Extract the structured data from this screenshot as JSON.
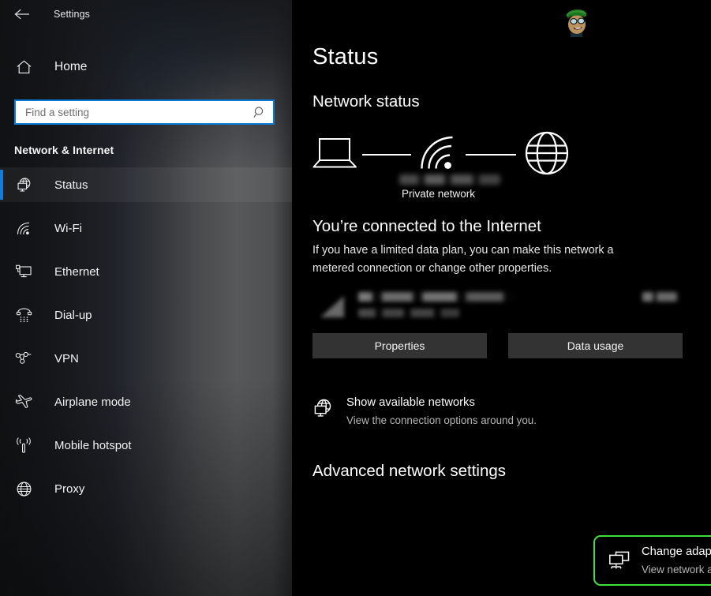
{
  "window": {
    "app_title": "Settings",
    "back_icon": "back-arrow-icon"
  },
  "sidebar": {
    "home": {
      "label": "Home",
      "icon": "home-icon"
    },
    "search": {
      "placeholder": "Find a setting",
      "value": "",
      "icon": "search-icon"
    },
    "category": "Network & Internet",
    "items": [
      {
        "label": "Status",
        "icon": "network-status-icon",
        "selected": true
      },
      {
        "label": "Wi-Fi",
        "icon": "wifi-icon",
        "selected": false
      },
      {
        "label": "Ethernet",
        "icon": "ethernet-icon",
        "selected": false
      },
      {
        "label": "Dial-up",
        "icon": "dialup-phone-icon",
        "selected": false
      },
      {
        "label": "VPN",
        "icon": "vpn-icon",
        "selected": false
      },
      {
        "label": "Airplane mode",
        "icon": "airplane-icon",
        "selected": false
      },
      {
        "label": "Mobile hotspot",
        "icon": "hotspot-icon",
        "selected": false
      },
      {
        "label": "Proxy",
        "icon": "globe-icon",
        "selected": false
      }
    ],
    "accent_color": "#0f7ce0"
  },
  "main": {
    "page_title": "Status",
    "section_network_status": "Network status",
    "diagram": {
      "device_icon": "laptop-icon",
      "signal_icon": "wifi-signal-icon",
      "internet_icon": "globe-icon",
      "ssid_label": "",
      "network_type": "Private network"
    },
    "connected_heading": "You’re connected to the Internet",
    "connected_description": "If you have a limited data plan, you can make this network a metered connection or change other properties.",
    "usage_row": {
      "name": "",
      "subtitle": "",
      "size": "",
      "icon": "wifi-usage-icon"
    },
    "buttons": {
      "properties": "Properties",
      "data_usage": "Data usage"
    },
    "show_networks": {
      "title": "Show available networks",
      "subtitle": "View the connection options around you.",
      "icon": "network-status-icon"
    },
    "section_advanced": "Advanced network settings",
    "change_adapter": {
      "title": "Change adapter options",
      "subtitle": "View network adapters and change connection settings.",
      "icon": "adapter-options-icon",
      "highlight_color": "#3ee03e"
    },
    "watermark_icon": "cartoon-face-watermark"
  }
}
